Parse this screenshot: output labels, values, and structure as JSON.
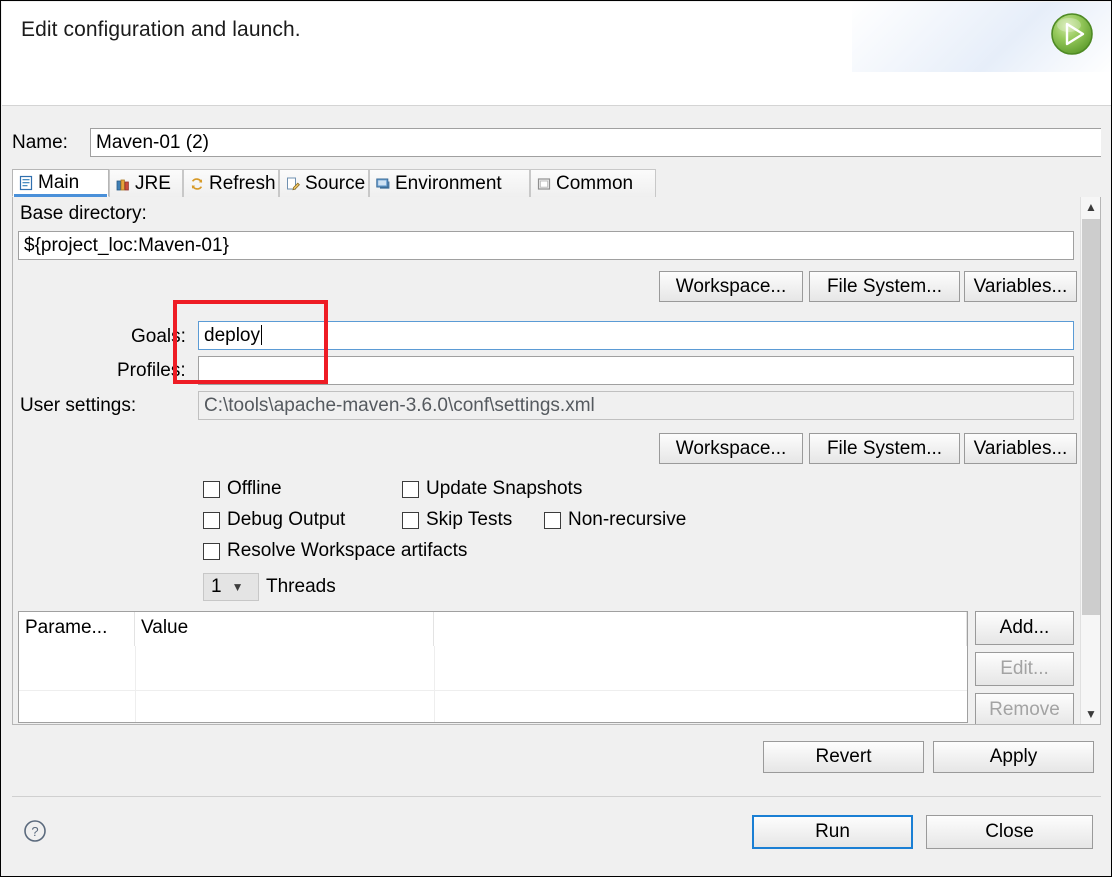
{
  "dialog": {
    "title": "Edit configuration and launch.",
    "run_badge_icon": "green-play-icon"
  },
  "name_field": {
    "label": "Name:",
    "value": "Maven-01 (2)"
  },
  "tabs": [
    {
      "label": "Main",
      "icon": "main-document-icon",
      "active": true
    },
    {
      "label": "JRE",
      "icon": "jre-books-icon",
      "active": false
    },
    {
      "label": "Refresh",
      "icon": "refresh-arrows-icon",
      "active": false
    },
    {
      "label": "Source",
      "icon": "source-pencil-icon",
      "active": false
    },
    {
      "label": "Environment",
      "icon": "environment-icon",
      "active": false
    },
    {
      "label": "Common",
      "icon": "common-window-icon",
      "active": false
    }
  ],
  "main_tab": {
    "base_directory": {
      "label": "Base directory:",
      "value": "${project_loc:Maven-01}"
    },
    "browse_buttons_top": [
      {
        "label": "Workspace..."
      },
      {
        "label": "File System..."
      },
      {
        "label": "Variables..."
      }
    ],
    "goals": {
      "label": "Goals:",
      "value": "deploy",
      "focused": true
    },
    "profiles": {
      "label": "Profiles:",
      "value": ""
    },
    "user_settings": {
      "label": "User settings:",
      "value": "C:\\tools\\apache-maven-3.6.0\\conf\\settings.xml"
    },
    "browse_buttons_bottom": [
      {
        "label": "Workspace..."
      },
      {
        "label": "File System..."
      },
      {
        "label": "Variables..."
      }
    ],
    "checkboxes": [
      {
        "label": "Offline",
        "checked": false
      },
      {
        "label": "Update Snapshots",
        "checked": false
      },
      {
        "label": "Debug Output",
        "checked": false
      },
      {
        "label": "Skip Tests",
        "checked": false
      },
      {
        "label": "Non-recursive",
        "checked": false
      },
      {
        "label": "Resolve Workspace artifacts",
        "checked": false
      }
    ],
    "threads": {
      "value": "1",
      "label": "Threads"
    },
    "parameters_table": {
      "columns": [
        "Parame...",
        "Value"
      ],
      "rows": []
    },
    "table_buttons": [
      {
        "label": "Add...",
        "enabled": true
      },
      {
        "label": "Edit...",
        "enabled": false
      },
      {
        "label": "Remove",
        "enabled": false
      }
    ]
  },
  "footer": {
    "revert_label": "Revert",
    "apply_label": "Apply",
    "run_label": "Run",
    "close_label": "Close",
    "help_icon": "question-mark-icon"
  },
  "annotation": {
    "highlight_color": "#ee1c25"
  }
}
